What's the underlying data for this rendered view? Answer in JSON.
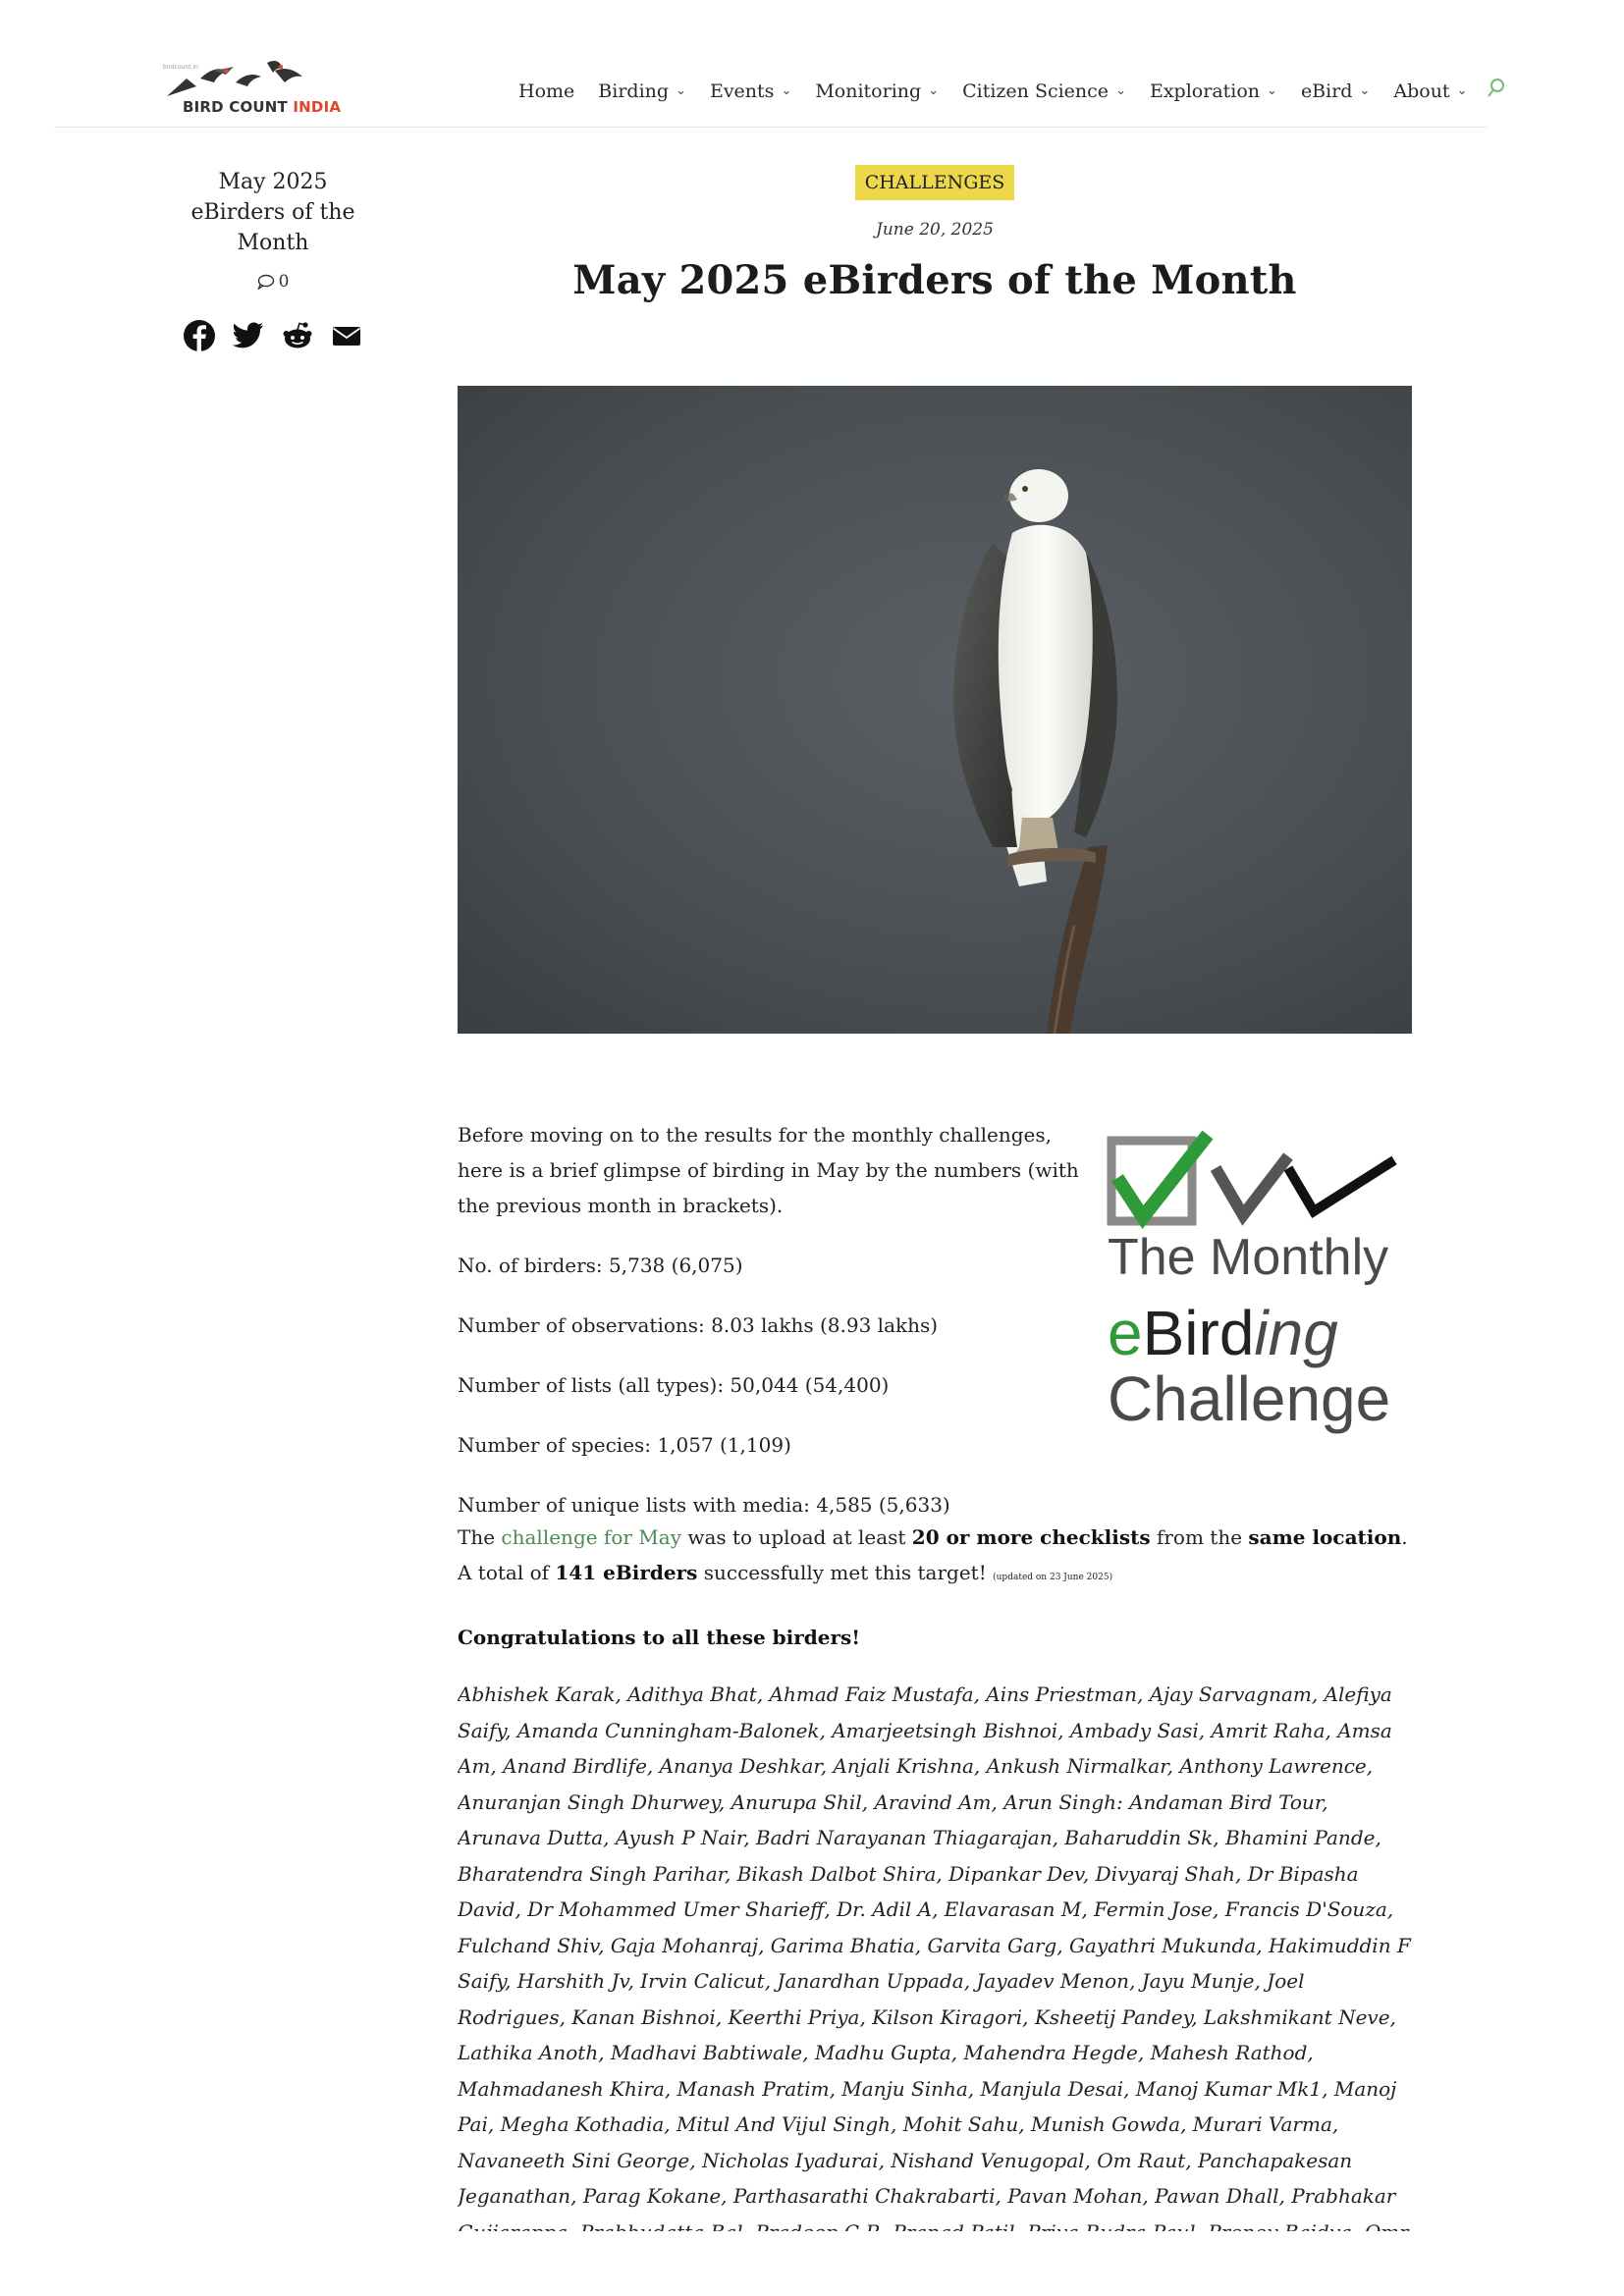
{
  "header": {
    "logo": {
      "small": "birdcount.in",
      "text_a": "BIRD COUNT ",
      "text_b": "INDIA"
    },
    "nav": [
      {
        "label": "Home",
        "dropdown": false
      },
      {
        "label": "Birding",
        "dropdown": true
      },
      {
        "label": "Events",
        "dropdown": true
      },
      {
        "label": "Monitoring",
        "dropdown": true
      },
      {
        "label": "Citizen Science",
        "dropdown": true
      },
      {
        "label": "Exploration",
        "dropdown": true
      },
      {
        "label": "eBird",
        "dropdown": true
      },
      {
        "label": "About",
        "dropdown": true
      }
    ]
  },
  "sidebar": {
    "title": "May 2025 eBirders of the Month",
    "comment_count": "0",
    "share": [
      "facebook-icon",
      "twitter-icon",
      "reddit-icon",
      "email-icon"
    ]
  },
  "post": {
    "category": "CHALLENGES",
    "date": "June 20, 2025",
    "title": "May 2025 eBirders of the Month",
    "intro": "Before moving on to the results for the monthly challenges, here is a brief glimpse of birding in May by the numbers (with the previous month in brackets).",
    "stats": [
      "No. of birders: 5,738 (6,075)",
      "Number of observations: 8.03 lakhs (8.93 lakhs)",
      "Number of lists (all types): 50,044 (54,400)",
      "Number of species: 1,057 (1,109)",
      "Number of unique lists with media: 4,585 (5,633)"
    ],
    "badge": {
      "line1": "The Monthly",
      "e": "e",
      "bird": "Bird",
      "ing": "ing",
      "line3": "Challenge"
    },
    "challenge": {
      "t1": "The ",
      "link": "challenge for May",
      "t2": " was to upload at least ",
      "b1": "20 or more checklists",
      "t3": " from the ",
      "b2": "same location",
      "t4": ". A total of ",
      "b3": "141 eBirders",
      "t5": " successfully met this target! ",
      "tiny": "(updated on 23 June 2025)"
    },
    "congrats": "Congratulations to all these birders!",
    "names": "Abhishek Karak, Adithya Bhat, Ahmad Faiz Mustafa, Ains Priestman, Ajay Sarvagnam, Alefiya Saify, Amanda Cunningham-Balonek, Amarjeetsingh Bishnoi, Ambady Sasi, Amrit Raha, Amsa Am, Anand Birdlife, Ananya Deshkar, Anjali Krishna, Ankush Nirmalkar, Anthony Lawrence, Anuranjan Singh Dhurwey, Anurupa Shil, Aravind Am, Arun Singh: Andaman Bird Tour, Arunava Dutta, Ayush P Nair, Badri Narayanan Thiagarajan, Baharuddin Sk, Bhamini Pande, Bharatendra Singh Parihar, Bikash Dalbot Shira, Dipankar Dev, Divyaraj Shah, Dr Bipasha David, Dr Mohammed Umer Sharieff, Dr. Adil A, Elavarasan M, Fermin Jose, Francis D'Souza, Fulchand Shiv, Gaja Mohanraj, Garima Bhatia, Garvita Garg, Gayathri Mukunda, Hakimuddin F Saify, Harshith Jv, Irvin Calicut, Janardhan Uppada, Jayadev Menon, Jayu Munje, Joel Rodrigues, Kanan Bishnoi, Keerthi Priya, Kilson Kiragori, Ksheetij Pandey, Lakshmikant Neve, Lathika Anoth, Madhavi Babtiwale, Madhu Gupta, Mahendra Hegde, Mahesh Rathod, Mahmadanesh Khira, Manash Pratim, Manju Sinha, Manjula Desai, Manoj Kumar Mk1, Manoj Pai, Megha Kothadia, Mitul And Vijul Singh, Mohit Sahu, Munish Gowda, Murari Varma, Navaneeth Sini George, Nicholas Iyadurai, Nishand Venugopal, Om Raut, Panchapakesan Jeganathan, Parag Kokane, Parthasarathi Chakrabarti, Pavan Mohan, Pawan Dhall, Prabhakar Gujjarappa, Prabhudatta Bal, Pradeep C R, Pranad Patil, Priya Rudra Paul, Pronoy Baidya, Qmr Telangana, R Sriram, Rachita Priyadarshini Sahoo, Rahul Wakare, Rajendra Koranga, Rajesh Radhakrishnan, Rajubhai Patel, Rakesh Bisht, Ramesh Shenai, Ramu Alluri, Ranjeet Chitrakar, Rasheeda Mol, Ravi Kaviraj, Regin Rose, Saddam Husain"
  }
}
